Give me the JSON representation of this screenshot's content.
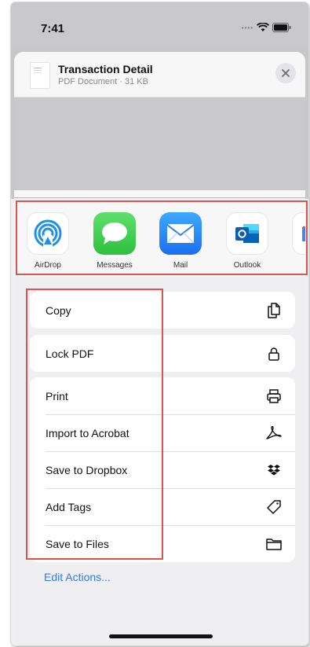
{
  "status_bar": {
    "time": "7:41"
  },
  "document": {
    "title": "Transaction Detail",
    "subtitle": "PDF Document · 31 KB"
  },
  "apps": [
    {
      "label": "AirDrop",
      "icon": "airdrop-icon"
    },
    {
      "label": "Messages",
      "icon": "messages-icon"
    },
    {
      "label": "Mail",
      "icon": "mail-icon"
    },
    {
      "label": "Outlook",
      "icon": "outlook-icon"
    }
  ],
  "actions": {
    "group1": [
      {
        "label": "Copy",
        "icon": "copy-icon"
      }
    ],
    "group2": [
      {
        "label": "Lock PDF",
        "icon": "lock-icon"
      }
    ],
    "group3": [
      {
        "label": "Print",
        "icon": "printer-icon"
      },
      {
        "label": "Import to Acrobat",
        "icon": "acrobat-icon"
      },
      {
        "label": "Save to Dropbox",
        "icon": "dropbox-icon"
      },
      {
        "label": "Add Tags",
        "icon": "tag-icon"
      },
      {
        "label": "Save to Files",
        "icon": "folder-icon"
      }
    ]
  },
  "edit_actions_label": "Edit Actions...",
  "colors": {
    "accent": "#2f7bf6",
    "highlight_box": "#d9534f"
  }
}
